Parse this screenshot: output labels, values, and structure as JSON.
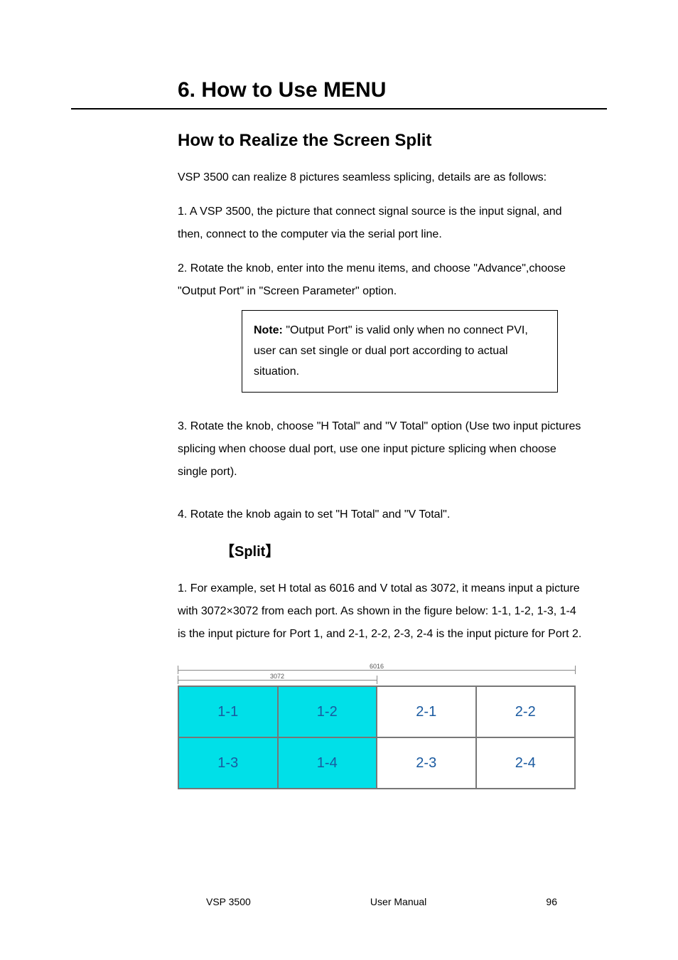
{
  "section_title": "6. How to Use MENU",
  "subhead": "How to Realize the Screen Split",
  "intro_p1": "VSP 3500 can realize 8 pictures seamless splicing, details are as follows:",
  "intro_p2": "1. A VSP 3500, the picture that connect signal source is the input signal, and then, connect to the computer via the serial port line.",
  "note_side": "2. Rotate the knob, enter into the menu items, and choose \"Advance\",choose \"Output Port\" in \"Screen Parameter\" option.",
  "note": {
    "label": "Note: ",
    "text": "\"Output Port\" is valid only when no connect PVI, user can set single or dual port according to actual situation."
  },
  "step3": "3. Rotate the knob, choose \"H Total\" and \"V Total\" option (Use two input pictures splicing when choose dual port, use one input picture splicing when choose single port).",
  "step4_a": "4. Rotate the knob again to set \"H Total\" and \"V Total\".",
  "step5_heading": "【Split】",
  "split_text_p1": "1. For example, set H total as 6016 and V total as 3072, it means input a picture with 3072×3072 from each port. As shown in the figure below: 1-1, 1-2, 1-3, 1-4 is the input picture for Port 1, and 2-1, 2-2, 2-3, 2-4 is the input picture for Port 2.",
  "dims": {
    "top": "6016",
    "mid": "3072"
  },
  "cells": [
    "1-1",
    "1-2",
    "2-1",
    "2-2",
    "1-3",
    "1-4",
    "2-3",
    "2-4"
  ],
  "footer": {
    "left": "VSP 3500",
    "mid": "User Manual",
    "right": "96"
  }
}
